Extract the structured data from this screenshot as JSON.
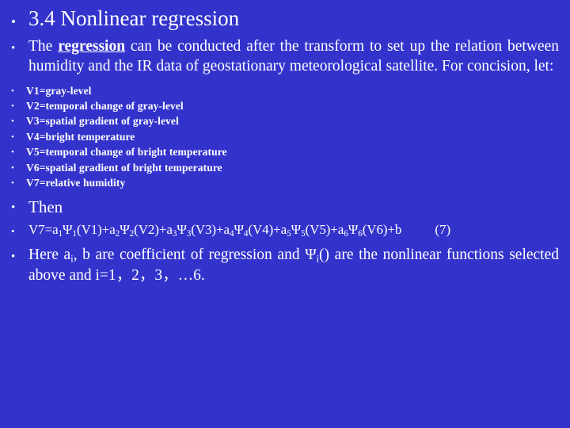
{
  "slide": {
    "background_color": "#3333CC",
    "text_color": "#FFFFFF",
    "bullet_glyph_level1": "•",
    "bullet_glyph_level2": "•",
    "title": "3.4 Nonlinear regression",
    "intro": {
      "before_emphasis": "The ",
      "emphasis": "regression",
      "after_emphasis": " can be conducted after the transform to set up the relation between humidity and the IR data of geostationary meteorological satellite. For concision, let:"
    },
    "variables": [
      "V1=gray-level",
      "V2=temporal change of gray-level",
      "V3=spatial gradient of gray-level",
      "V4=bright temperature",
      "V5=temporal change of bright temperature",
      "V6=spatial gradient of bright temperature",
      "V7=relative humidity"
    ],
    "then_label": "Then",
    "formula": {
      "text": "V7=a1Ψ1(V1)+a2Ψ2(V2)+a3Ψ3(V3)+a4Ψ4(V4)+a5Ψ5(V5)+a6Ψ6(V6)+b",
      "lhs": "V7=",
      "terms": [
        {
          "coef": "a",
          "coef_sub": "1",
          "func": "Ψ",
          "func_sub": "1",
          "arg": "(V1)",
          "op": "+"
        },
        {
          "coef": "a",
          "coef_sub": "2",
          "func": "Ψ",
          "func_sub": "2",
          "arg": "(V2)",
          "op": "+"
        },
        {
          "coef": "a",
          "coef_sub": "3",
          "func": "Ψ",
          "func_sub": "3",
          "arg": "(V3)",
          "op": "+"
        },
        {
          "coef": "a",
          "coef_sub": "4",
          "func": "Ψ",
          "func_sub": "4",
          "arg": "(V4)",
          "op": "+"
        },
        {
          "coef": "a",
          "coef_sub": "5",
          "func": "Ψ",
          "func_sub": "5",
          "arg": "(V5)",
          "op": "+"
        },
        {
          "coef": "a",
          "coef_sub": "6",
          "func": "Ψ",
          "func_sub": "6",
          "arg": "(V6)",
          "op": "+"
        }
      ],
      "constant": "b",
      "number": "(7)"
    },
    "closing": {
      "part1": "Here a",
      "sub1": "i",
      "part2": ", b are coefficient of regression and ",
      "psi": "Ψ",
      "sub2": "i",
      "part3": "() are the nonlinear functions selected above and i=1，2，3，…6."
    }
  }
}
